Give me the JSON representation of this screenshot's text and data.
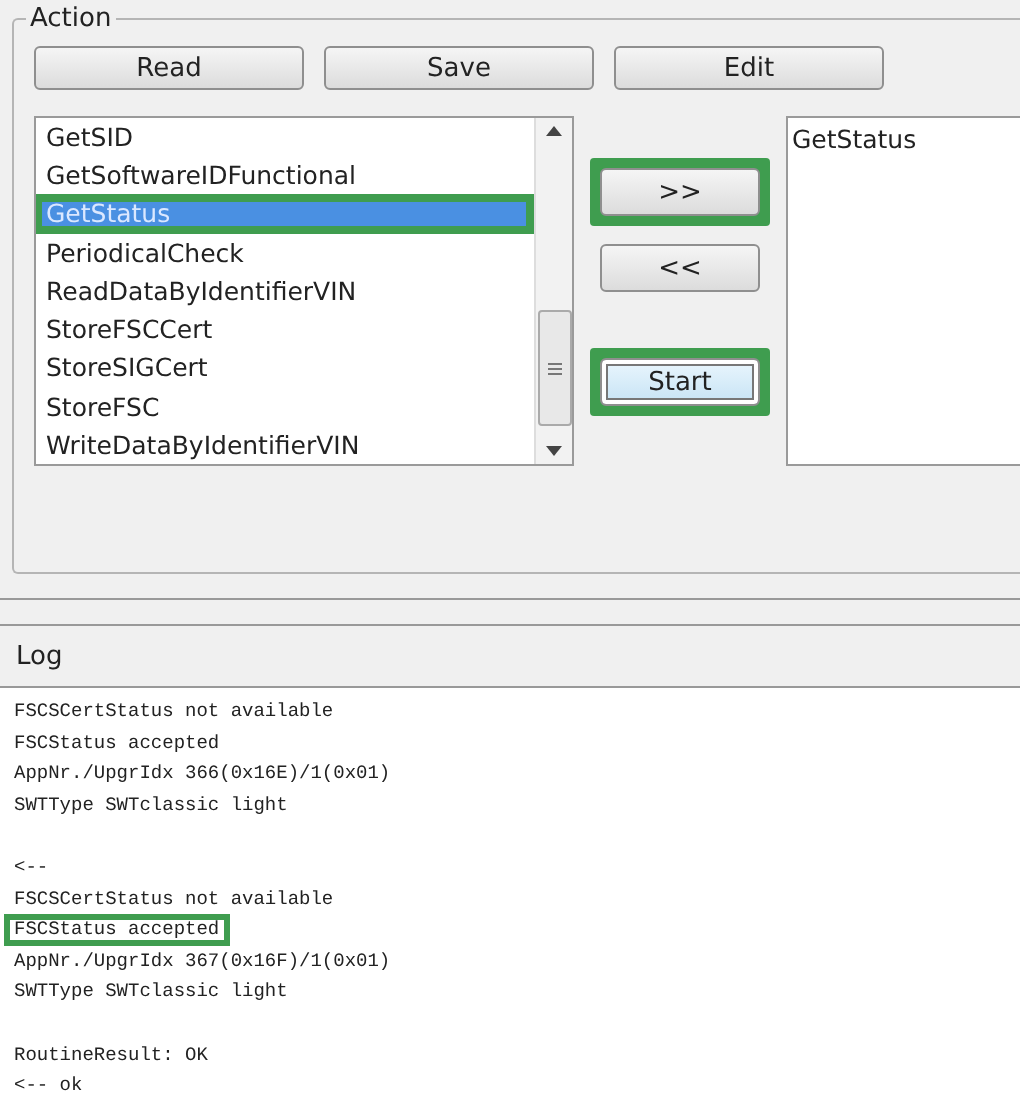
{
  "action_group": {
    "title": "Action",
    "buttons": [
      {
        "label": "Read"
      },
      {
        "label": "Save"
      },
      {
        "label": "Edit"
      }
    ],
    "available_list": [
      {
        "label": "GetSID",
        "selected": false,
        "highlighted": false
      },
      {
        "label": "GetSoftwareIDFunctional",
        "selected": false,
        "highlighted": false
      },
      {
        "label": "GetStatus",
        "selected": true,
        "highlighted": true
      },
      {
        "label": "PeriodicalCheck",
        "selected": false,
        "highlighted": false
      },
      {
        "label": "ReadDataByIdentifierVIN",
        "selected": false,
        "highlighted": false
      },
      {
        "label": "StoreFSCCert",
        "selected": false,
        "highlighted": false
      },
      {
        "label": "StoreSIGCert",
        "selected": false,
        "highlighted": false
      },
      {
        "label": "StoreFSC",
        "selected": false,
        "highlighted": false
      },
      {
        "label": "WriteDataByIdentifierVIN",
        "selected": false,
        "highlighted": false
      }
    ],
    "move_buttons": [
      {
        "label": ">>",
        "highlighted": true,
        "focused": false
      },
      {
        "label": "<<",
        "highlighted": false,
        "focused": false
      },
      {
        "label": "Start",
        "highlighted": true,
        "focused": true
      }
    ],
    "chosen_list": [
      {
        "label": "GetStatus"
      }
    ]
  },
  "log": {
    "title": "Log",
    "blocks": [
      [
        {
          "text": "FSCSCertStatus not available",
          "highlighted": false
        },
        {
          "text": "FSCStatus accepted",
          "highlighted": false
        },
        {
          "text": "AppNr./UpgrIdx 366(0x16E)/1(0x01)",
          "highlighted": false
        },
        {
          "text": "SWTType SWTclassic light",
          "highlighted": false
        }
      ],
      [
        {
          "text": "<--",
          "highlighted": false
        },
        {
          "text": "FSCSCertStatus not available",
          "highlighted": false
        },
        {
          "text": "FSCStatus accepted",
          "highlighted": true
        },
        {
          "text": "AppNr./UpgrIdx 367(0x16F)/1(0x01)",
          "highlighted": false
        },
        {
          "text": "SWTType SWTclassic light",
          "highlighted": false
        }
      ],
      [
        {
          "text": "RoutineResult: OK",
          "highlighted": false
        },
        {
          "text": "<-- ok",
          "highlighted": false
        }
      ]
    ]
  }
}
